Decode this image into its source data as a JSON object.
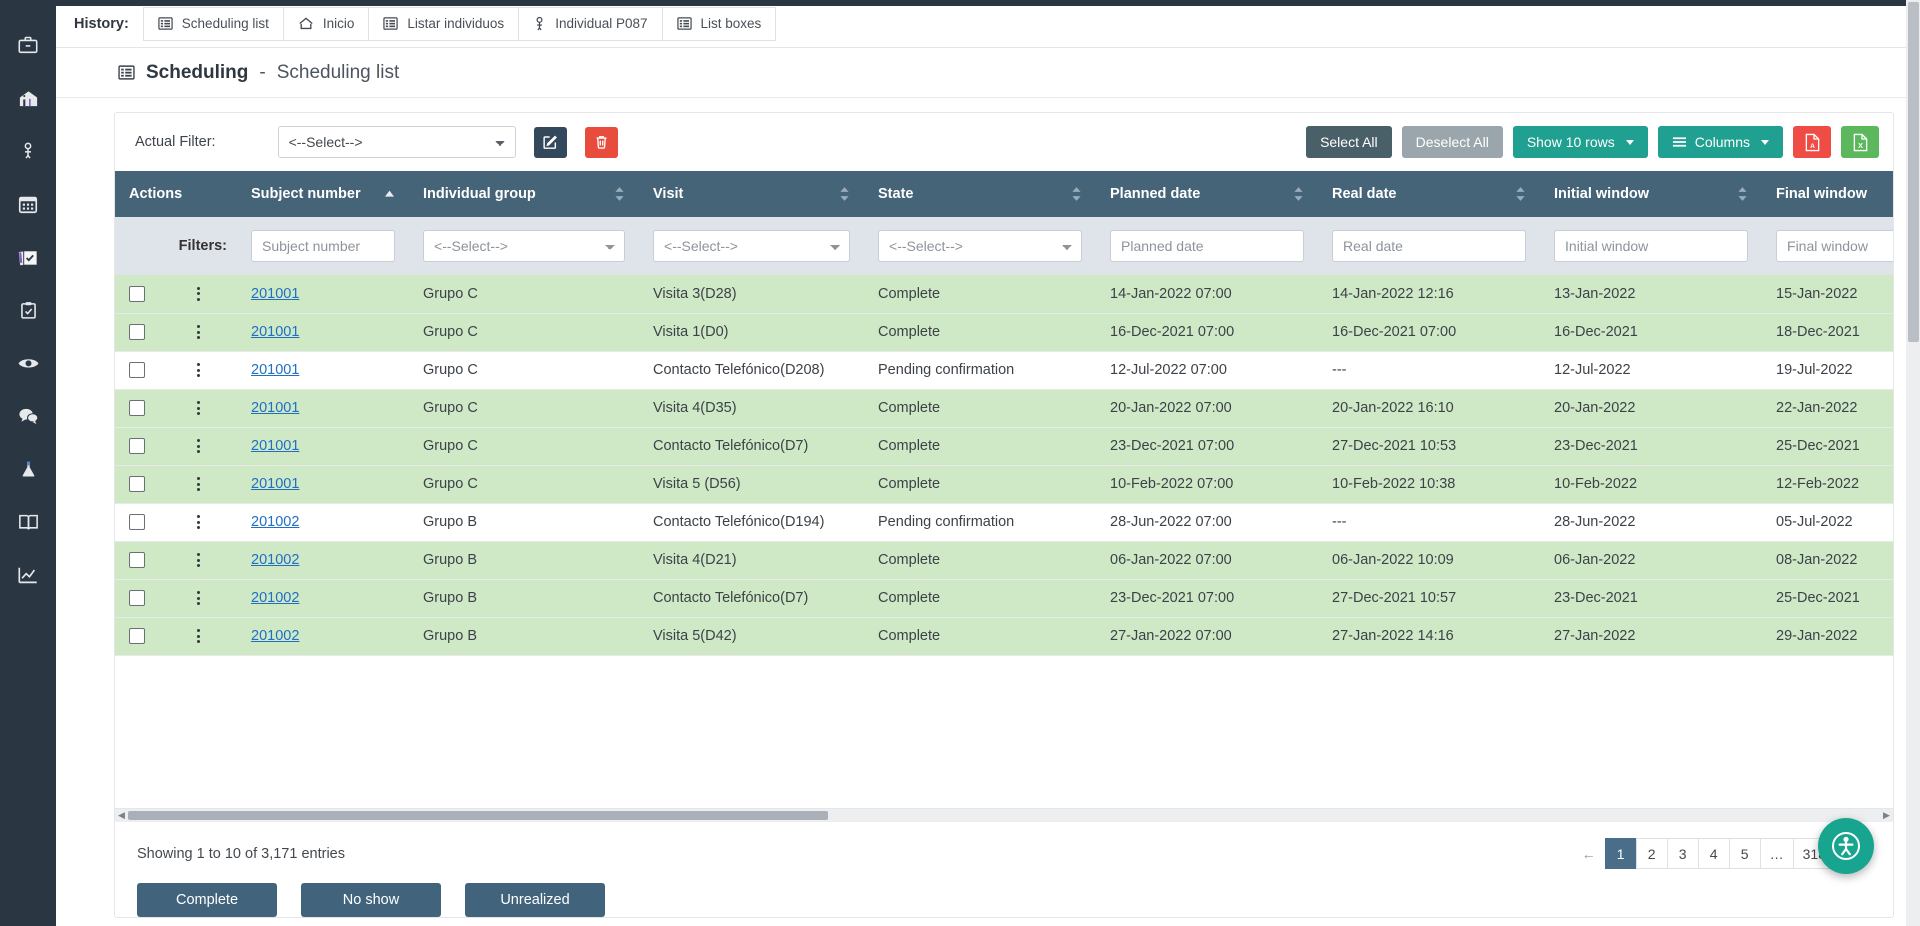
{
  "sidebar": {
    "items": [
      {
        "name": "briefcase-icon",
        "label": "Projects"
      },
      {
        "name": "building-icon",
        "label": "Sites"
      },
      {
        "name": "person-icon",
        "label": "Individuals"
      },
      {
        "name": "calendar-icon",
        "label": "Scheduling"
      },
      {
        "name": "forms-icon",
        "label": "Forms"
      },
      {
        "name": "clipboard-check-icon",
        "label": "Tasks"
      },
      {
        "name": "eye-icon",
        "label": "Monitoring"
      },
      {
        "name": "chat-icon",
        "label": "Queries"
      },
      {
        "name": "flask-icon",
        "label": "Lab"
      },
      {
        "name": "book-icon",
        "label": "Documents"
      },
      {
        "name": "chart-icon",
        "label": "Reports"
      }
    ]
  },
  "history": {
    "label": "History:",
    "items": [
      {
        "icon": "table-icon",
        "label": "Scheduling list"
      },
      {
        "icon": "home-icon",
        "label": "Inicio"
      },
      {
        "icon": "table-icon",
        "label": "Listar individuos"
      },
      {
        "icon": "person-icon",
        "label": "Individual P087"
      },
      {
        "icon": "table-icon",
        "label": "List boxes"
      }
    ]
  },
  "page": {
    "icon": "table-icon",
    "title": "Scheduling",
    "separator": "-",
    "subtitle": "Scheduling list"
  },
  "toolbar": {
    "filter_label": "Actual Filter:",
    "filter_value": "<--Select-->",
    "edit_icon": "edit-square-icon",
    "delete_icon": "trash-icon",
    "select_all": "Select All",
    "deselect_all": "Deselect All",
    "show_rows": "Show 10 rows",
    "columns": "Columns",
    "pdf_icon": "pdf-file-icon",
    "excel_icon": "excel-file-icon"
  },
  "table": {
    "columns": [
      {
        "label": "Actions",
        "sortable": false
      },
      {
        "label": "Subject number",
        "sortable": true,
        "sort": "asc"
      },
      {
        "label": "Individual group",
        "sortable": true
      },
      {
        "label": "Visit",
        "sortable": true
      },
      {
        "label": "State",
        "sortable": true
      },
      {
        "label": "Planned date",
        "sortable": true
      },
      {
        "label": "Real date",
        "sortable": true
      },
      {
        "label": "Initial window",
        "sortable": true
      },
      {
        "label": "Final window",
        "sortable": true
      }
    ],
    "filters_label": "Filters:",
    "filters": [
      {
        "type": "none"
      },
      {
        "type": "text",
        "placeholder": "Subject number",
        "value": ""
      },
      {
        "type": "select",
        "value": "<--Select-->"
      },
      {
        "type": "select",
        "value": "<--Select-->"
      },
      {
        "type": "select",
        "value": "<--Select-->"
      },
      {
        "type": "text",
        "placeholder": "Planned date",
        "value": ""
      },
      {
        "type": "text",
        "placeholder": "Real date",
        "value": ""
      },
      {
        "type": "text",
        "placeholder": "Initial window",
        "value": ""
      },
      {
        "type": "text",
        "placeholder": "Final window",
        "value": ""
      }
    ],
    "rows": [
      {
        "subject": "201001",
        "group": "Grupo C",
        "visit": "Visita 3(D28)",
        "state": "Complete",
        "planned": "14-Jan-2022 07:00",
        "real": "14-Jan-2022 12:16",
        "initial": "13-Jan-2022",
        "final": "15-Jan-2022",
        "highlight": "green"
      },
      {
        "subject": "201001",
        "group": "Grupo C",
        "visit": "Visita 1(D0)",
        "state": "Complete",
        "planned": "16-Dec-2021 07:00",
        "real": "16-Dec-2021 07:00",
        "initial": "16-Dec-2021",
        "final": "18-Dec-2021",
        "highlight": "green"
      },
      {
        "subject": "201001",
        "group": "Grupo C",
        "visit": "Contacto Telefónico(D208)",
        "state": "Pending confirmation",
        "planned": "12-Jul-2022 07:00",
        "real": "---",
        "initial": "12-Jul-2022",
        "final": "19-Jul-2022",
        "highlight": "white"
      },
      {
        "subject": "201001",
        "group": "Grupo C",
        "visit": "Visita 4(D35)",
        "state": "Complete",
        "planned": "20-Jan-2022 07:00",
        "real": "20-Jan-2022 16:10",
        "initial": "20-Jan-2022",
        "final": "22-Jan-2022",
        "highlight": "green"
      },
      {
        "subject": "201001",
        "group": "Grupo C",
        "visit": "Contacto Telefónico(D7)",
        "state": "Complete",
        "planned": "23-Dec-2021 07:00",
        "real": "27-Dec-2021 10:53",
        "initial": "23-Dec-2021",
        "final": "25-Dec-2021",
        "highlight": "green"
      },
      {
        "subject": "201001",
        "group": "Grupo C",
        "visit": "Visita 5 (D56)",
        "state": "Complete",
        "planned": "10-Feb-2022 07:00",
        "real": "10-Feb-2022 10:38",
        "initial": "10-Feb-2022",
        "final": "12-Feb-2022",
        "highlight": "green"
      },
      {
        "subject": "201002",
        "group": "Grupo B",
        "visit": "Contacto Telefónico(D194)",
        "state": "Pending confirmation",
        "planned": "28-Jun-2022 07:00",
        "real": "---",
        "initial": "28-Jun-2022",
        "final": "05-Jul-2022",
        "highlight": "white"
      },
      {
        "subject": "201002",
        "group": "Grupo B",
        "visit": "Visita 4(D21)",
        "state": "Complete",
        "planned": "06-Jan-2022 07:00",
        "real": "06-Jan-2022 10:09",
        "initial": "06-Jan-2022",
        "final": "08-Jan-2022",
        "highlight": "green"
      },
      {
        "subject": "201002",
        "group": "Grupo B",
        "visit": "Contacto Telefónico(D7)",
        "state": "Complete",
        "planned": "23-Dec-2021 07:00",
        "real": "27-Dec-2021 10:57",
        "initial": "23-Dec-2021",
        "final": "25-Dec-2021",
        "highlight": "green"
      },
      {
        "subject": "201002",
        "group": "Grupo B",
        "visit": "Visita 5(D42)",
        "state": "Complete",
        "planned": "27-Jan-2022 07:00",
        "real": "27-Jan-2022 14:16",
        "initial": "27-Jan-2022",
        "final": "29-Jan-2022",
        "highlight": "green"
      }
    ]
  },
  "footer": {
    "showing": "Showing 1 to 10 of 3,171 entries",
    "pagination": {
      "prev": "←",
      "pages": [
        "1",
        "2",
        "3",
        "4",
        "5",
        "…",
        "318"
      ],
      "active": "1",
      "next": "→"
    },
    "actions": [
      {
        "label": "Complete"
      },
      {
        "label": "No show"
      },
      {
        "label": "Unrealized"
      }
    ]
  },
  "fab": {
    "icon": "accessibility-icon"
  },
  "colors": {
    "rail": "#2b3643",
    "header": "#456478",
    "filter_row": "#dfe3ea",
    "row_green": "#cfe9c6",
    "teal": "#1fa090",
    "red": "#ee4c44",
    "green": "#5cb85c",
    "slate": "#4a6069",
    "gray": "#9aa6ac",
    "link": "#1f6fc4",
    "action": "#41647c",
    "fab": "#18a58f"
  }
}
